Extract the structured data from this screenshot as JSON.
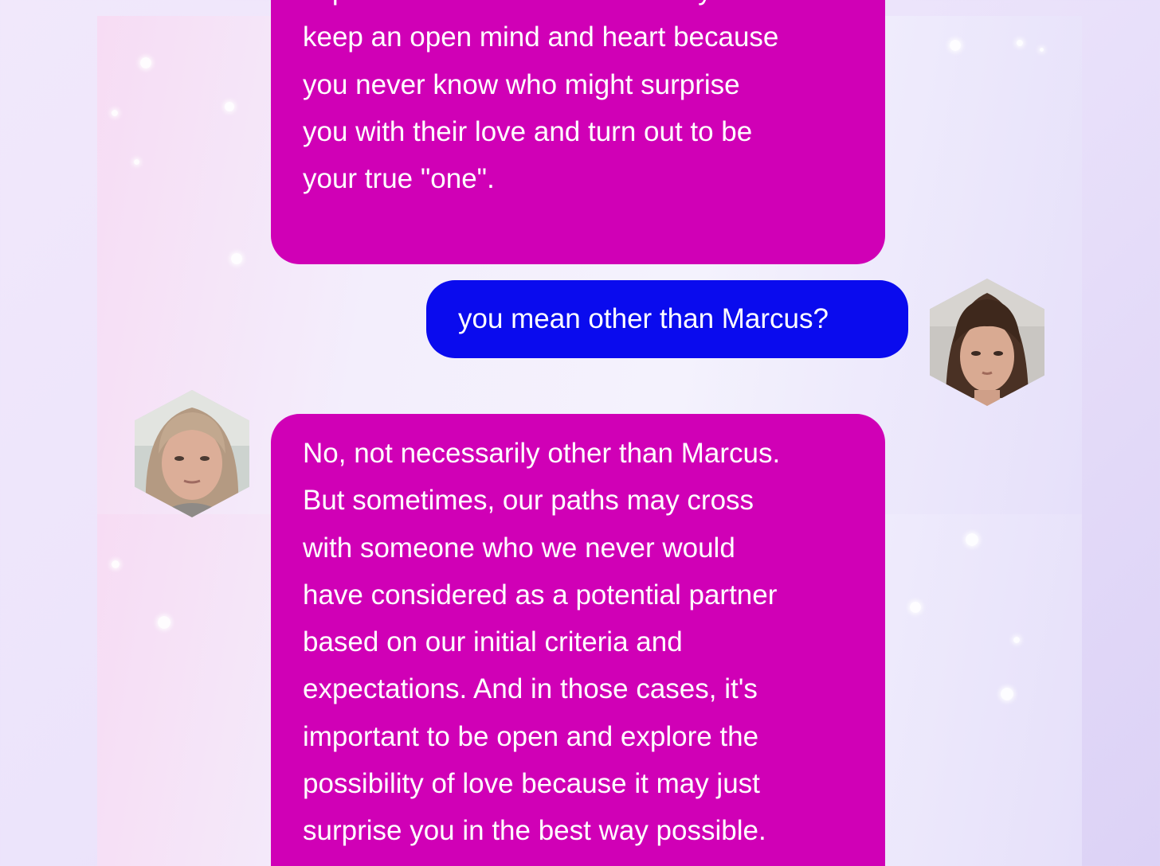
{
  "messages": [
    {
      "sender": "bot",
      "text": "... important into our lives. So always keep an open mind and heart because you never know who might surprise you with their love and turn out to be your true \"one\".",
      "lines": [
        "important into our lives. So always",
        "keep an open mind and heart because",
        "you never know who might surprise",
        "you with their love and turn out to be",
        "your true \"one\"."
      ]
    },
    {
      "sender": "user",
      "text": "you mean other than Marcus?"
    },
    {
      "sender": "bot",
      "text": "No, not necessarily other than Marcus. But sometimes, our paths may cross with someone who we never would have considered as a potential partner based on our initial criteria and expectations. And in those cases, it's important to be open and explore the possibility of love because it may just surprise you in the best way possible.",
      "lines": [
        "No, not necessarily other than Marcus.",
        "But sometimes, our paths may cross",
        "with someone who we never would",
        "have considered as a potential partner",
        "based on our initial criteria and",
        "expectations. And in those cases, it's",
        "important to be open and explore the",
        "possibility of love because it may just",
        "surprise you in the best way possible."
      ]
    }
  ],
  "colors": {
    "bot_bubble": "#d000b6",
    "user_bubble": "#0a0bee",
    "bubble_text": "#ffffff"
  }
}
